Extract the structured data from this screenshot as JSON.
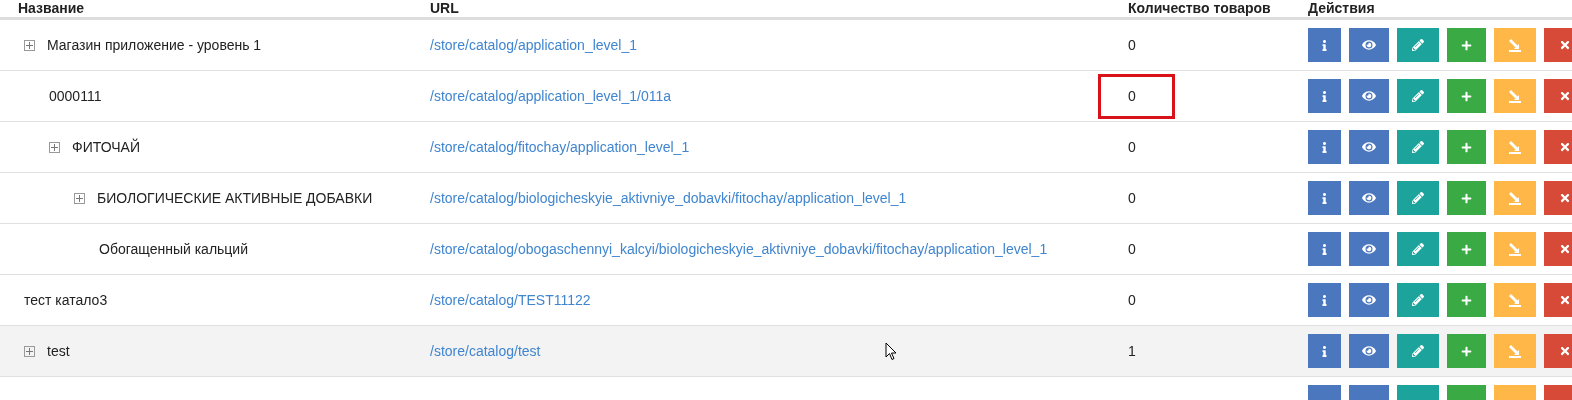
{
  "table": {
    "columns": [
      "Название",
      "URL",
      "Количество товаров",
      "Действия"
    ],
    "rows": [
      {
        "name": "Магазин приложение - уровень 1",
        "expandable": true,
        "url": "/store/catalog/application_level_1",
        "count": "0",
        "highlighted": false,
        "hovered": false,
        "children": [
          {
            "name": "0000111",
            "expandable": false,
            "url": "/store/catalog/application_level_1/011a",
            "count": "0",
            "highlighted": true,
            "hovered": false
          },
          {
            "name": "ФИТОЧАЙ",
            "expandable": true,
            "url": "/store/catalog/fitochay/application_level_1",
            "count": "0",
            "highlighted": false,
            "hovered": false,
            "children": [
              {
                "name": "БИОЛОГИЧЕСКИЕ АКТИВНЫЕ ДОБАВКИ",
                "expandable": true,
                "url": "/store/catalog/biologicheskyie_aktivniye_dobavki/fitochay/application_level_1",
                "count": "0",
                "highlighted": false,
                "hovered": false,
                "children": [
                  {
                    "name": "Обогащенный кальций",
                    "expandable": false,
                    "url": "/store/catalog/obogaschennyi_kalcyi/biologicheskyie_aktivniye_dobavki/fitochay/application_level_1",
                    "count": "0",
                    "highlighted": false,
                    "hovered": false
                  }
                ]
              }
            ]
          }
        ]
      },
      {
        "name": "тест катало3",
        "expandable": false,
        "url": "/store/catalog/TEST11122",
        "count": "0",
        "highlighted": false,
        "hovered": false
      },
      {
        "name": "test",
        "expandable": true,
        "url": "/store/catalog/test",
        "count": "1",
        "highlighted": false,
        "hovered": true
      },
      {}
    ]
  }
}
